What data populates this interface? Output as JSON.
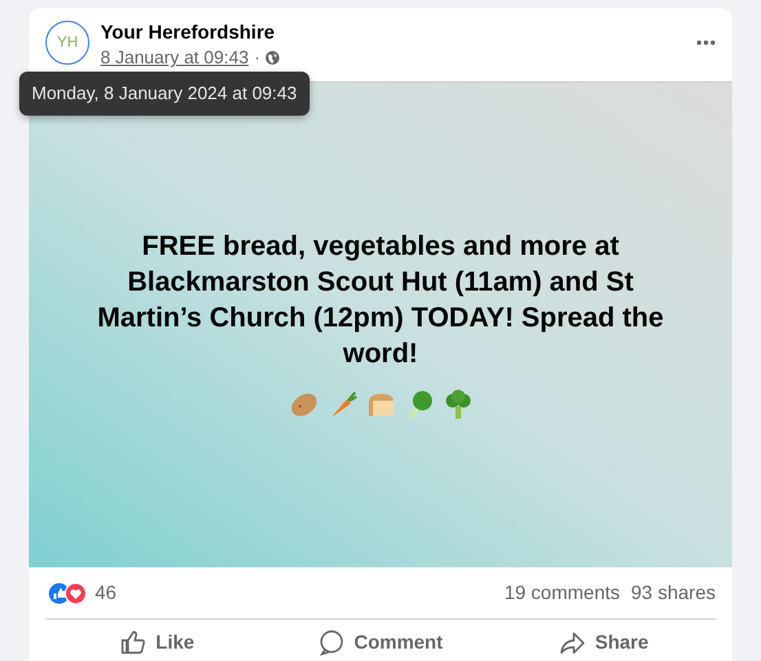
{
  "post": {
    "page_name": "Your Herefordshire",
    "logo_text": "YH",
    "timestamp": "8 January at 09:43",
    "separator": "·",
    "tooltip": "Monday, 8 January 2024 at 09:43",
    "message": "FREE bread, vegetables and more at Blackmarston Scout Hut (11am) and St Martin’s Church (12pm) TODAY! Spread the word!",
    "emoji": [
      {
        "kind": "potato"
      },
      {
        "kind": "carrot"
      },
      {
        "kind": "bread"
      },
      {
        "kind": "greens"
      },
      {
        "kind": "broccoli"
      }
    ],
    "reaction_count": "46",
    "comments": "19 comments",
    "shares": "93 shares",
    "actions": [
      {
        "kind": "like",
        "label": "Like"
      },
      {
        "kind": "comment",
        "label": "Comment"
      },
      {
        "kind": "share",
        "label": "Share"
      }
    ]
  }
}
